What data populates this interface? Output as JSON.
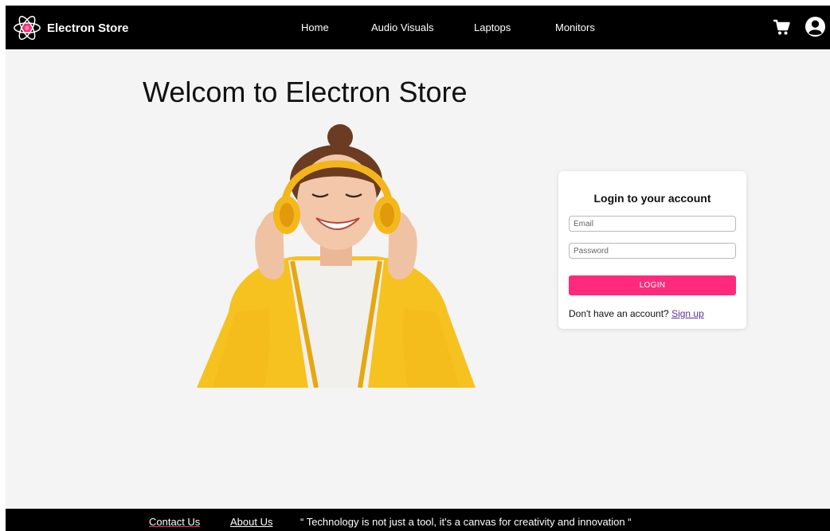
{
  "navbar": {
    "brand_name": "Electron Store",
    "links": [
      {
        "label": "Home"
      },
      {
        "label": "Audio Visuals"
      },
      {
        "label": "Laptops"
      },
      {
        "label": "Monitors"
      }
    ],
    "icons": [
      "cart-icon",
      "user-account-icon"
    ]
  },
  "main": {
    "welcome_title": "Welcom to Electron Store"
  },
  "login": {
    "title": "Login to your account",
    "email_placeholder": "Email",
    "password_placeholder": "Password",
    "button_label": "LOGIN",
    "signup_prompt": "Don't have an account?",
    "signup_link": "Sign up"
  },
  "footer": {
    "contact": "Contact Us",
    "about": "About Us",
    "quote": "“ Technology is not just a tool, it's a canvas for creativity and innovation “"
  },
  "colors": {
    "nav_background": "#000000",
    "page_background": "#f4f4f4",
    "accent": "#ff2a7b",
    "link": "#5a2ea0"
  }
}
